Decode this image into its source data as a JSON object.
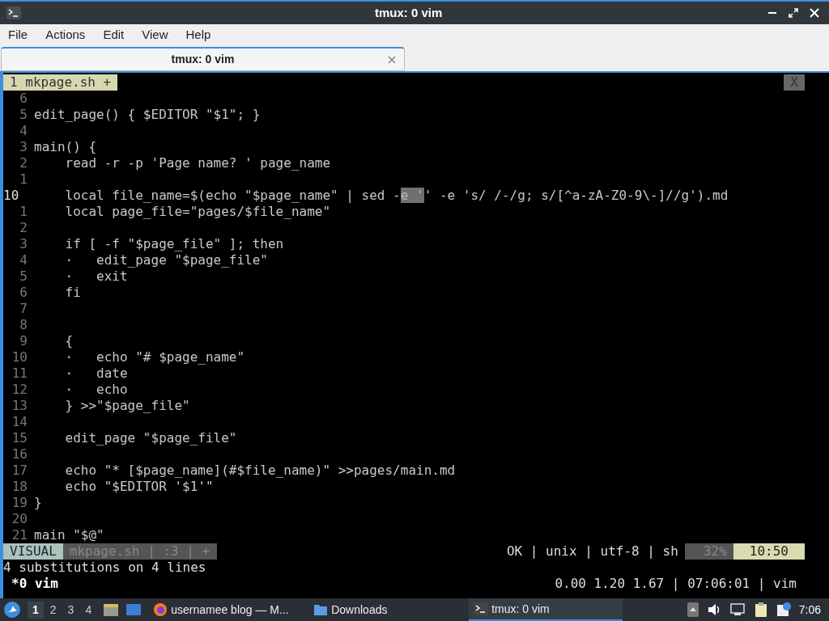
{
  "window": {
    "title": "tmux: 0 vim"
  },
  "menu": [
    "File",
    "Actions",
    "Edit",
    "View",
    "Help"
  ],
  "tabs": [
    {
      "label": "tmux: 0 vim",
      "selected": true
    }
  ],
  "vim": {
    "buffer_tab": "1 mkpage.sh +",
    "close_label": "X",
    "lines": [
      {
        "number": "6",
        "current": false
      },
      {
        "number": "5",
        "text": "edit_page() { $EDITOR \"$1\"; }",
        "current": false
      },
      {
        "number": "4",
        "current": false
      },
      {
        "number": "3",
        "text": "main() {",
        "current": false
      },
      {
        "number": "2",
        "text": "    read -r -p 'Page name? ' page_name",
        "current": false
      },
      {
        "number": "1",
        "current": false
      },
      {
        "number": "10",
        "current": true,
        "segments": [
          {
            "text": "    local file_name=$(echo \"$page_name\" | sed -",
            "selected": false
          },
          {
            "text": "e '",
            "selected": true
          },
          {
            "text": "' -e 's/ /-/g; s/[^a-zA-Z0-9\\-]//g').md",
            "selected": false
          }
        ]
      },
      {
        "number": "1",
        "text": "    local page_file=\"pages/$file_name\"",
        "current": false
      },
      {
        "number": "2",
        "current": false
      },
      {
        "number": "3",
        "text": "    if [ -f \"$page_file\" ]; then",
        "current": false
      },
      {
        "number": "4",
        "text": "    ·   edit_page \"$page_file\"",
        "current": false
      },
      {
        "number": "5",
        "text": "    ·   exit",
        "current": false
      },
      {
        "number": "6",
        "text": "    fi",
        "current": false
      },
      {
        "number": "7",
        "current": false
      },
      {
        "number": "8",
        "current": false
      },
      {
        "number": "9",
        "text": "    {",
        "current": false
      },
      {
        "number": "10",
        "text": "    ·   echo \"# $page_name\"",
        "current": false
      },
      {
        "number": "11",
        "text": "    ·   date",
        "current": false
      },
      {
        "number": "12",
        "text": "    ·   echo",
        "current": false
      },
      {
        "number": "13",
        "text": "    } >>\"$page_file\"",
        "current": false
      },
      {
        "number": "14",
        "current": false
      },
      {
        "number": "15",
        "text": "    edit_page \"$page_file\"",
        "current": false
      },
      {
        "number": "16",
        "current": false
      },
      {
        "number": "17",
        "text": "    echo \"* [$page_name](#$file_name)\" >>pages/main.md",
        "current": false
      },
      {
        "number": "18",
        "text": "    echo \"$EDITOR '$1'\"",
        "current": false
      },
      {
        "number": "19",
        "text": "}",
        "current": false
      },
      {
        "number": "20",
        "current": false
      },
      {
        "number": "21",
        "text": "main \"$@\"",
        "current": false
      }
    ],
    "status_line": {
      "mode": "VISUAL",
      "file_info": "mkpage.sh | :3 | +",
      "file_status": "OK | unix | utf-8 | sh",
      "percent": "32%",
      "position": "10:50"
    },
    "message": "4 substitutions on 4 lines"
  },
  "tmux_status": {
    "window": "*0 vim",
    "right": "0.00 1.20 1.67 | 07:06:01 | vim"
  },
  "taskbar": {
    "workspaces": [
      {
        "label": "1",
        "selected": true
      },
      {
        "label": "2",
        "selected": false
      },
      {
        "label": "3",
        "selected": false
      },
      {
        "label": "4",
        "selected": false
      }
    ],
    "tasks": [
      {
        "kind": "browser",
        "label": "usernamee blog — M...",
        "selected": false
      },
      {
        "kind": "folder",
        "label": "Downloads",
        "selected": false
      },
      {
        "kind": "terminal",
        "label": "tmux: 0 vim",
        "selected": true
      }
    ],
    "clock": "7:06"
  }
}
